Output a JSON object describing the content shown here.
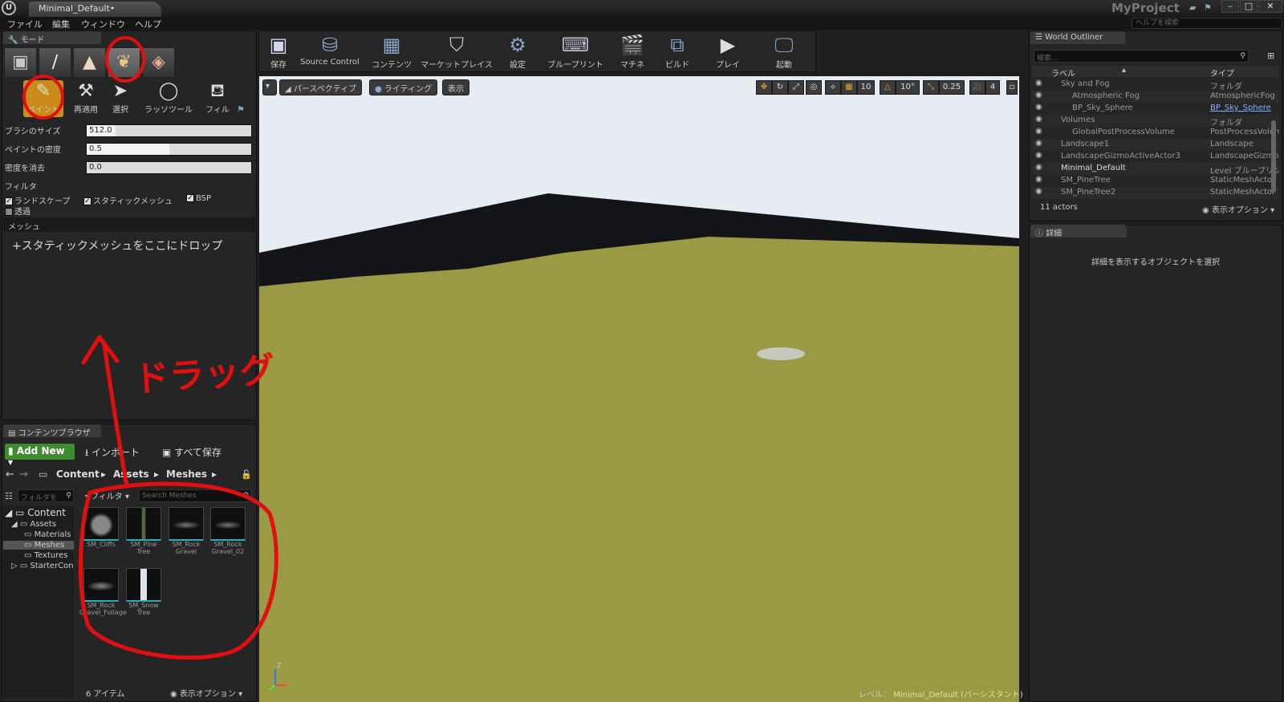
{
  "window": {
    "doc_tab": "Minimal_Default•",
    "project_name": "MyProject",
    "help_placeholder": "ヘルプを検索"
  },
  "menu": [
    "ファイル",
    "編集",
    "ウィンドウ",
    "ヘルプ"
  ],
  "modes": {
    "tab": "モード",
    "tools": [
      "ペイント",
      "再適用",
      "選択",
      "ラッソツール",
      "フィル"
    ],
    "brush_size_label": "ブラシのサイズ",
    "brush_size_value": "512.0",
    "paint_density_label": "ペイントの密度",
    "paint_density_value": "0.5",
    "paint_density_fraction": 0.5,
    "erase_density_label": "密度を消去",
    "erase_density_value": "0.0",
    "filter_label": "フィルタ",
    "filters": [
      {
        "label": "ランドスケープ",
        "checked": true
      },
      {
        "label": "スタティックメッシュ",
        "checked": true
      },
      {
        "label": "BSP",
        "checked": true
      },
      {
        "label": "透過",
        "checked": false
      }
    ],
    "mesh_section": "メッシュ",
    "drop_hint": "+スタティックメッシュをここにドロップ"
  },
  "content_browser": {
    "tab": "コンテンツブラウザ",
    "add_new": "Add New",
    "import": "インポート",
    "save_all": "すべて保存",
    "breadcrumb": [
      "Content",
      "Assets",
      "Meshes"
    ],
    "folder_search_placeholder": "フォルダを",
    "filter_button": "フィルタ",
    "search_placeholder": "Search Meshes",
    "tree": [
      {
        "label": "Content",
        "level": 0
      },
      {
        "label": "Assets",
        "level": 1
      },
      {
        "label": "Materials",
        "level": 2
      },
      {
        "label": "Meshes",
        "level": 2
      },
      {
        "label": "Textures",
        "level": 2
      },
      {
        "label": "StarterCon",
        "level": 1
      }
    ],
    "assets": [
      {
        "line1": "SM_Cliffs",
        "line2": ""
      },
      {
        "line1": "SM_Pine",
        "line2": "Tree"
      },
      {
        "line1": "SM_Rock",
        "line2": "Gravel"
      },
      {
        "line1": "SM_Rock",
        "line2": "Gravel_02"
      },
      {
        "line1": "SM_Rock",
        "line2": "Gravel_Foliage"
      },
      {
        "line1": "SM_Snow",
        "line2": "Tree"
      }
    ],
    "item_count": "6 アイテム",
    "view_options": "表示オプション"
  },
  "toolbar": [
    "保存",
    "Source Control",
    "コンテンツ",
    "マーケットプレイス",
    "設定",
    "ブループリント",
    "マチネ",
    "ビルド",
    "プレイ",
    "起動"
  ],
  "viewport": {
    "perspective": "パースペクティブ",
    "lighting": "ライティング",
    "show": "表示",
    "grid_snap": "10",
    "rot_snap": "10°",
    "scale_snap": "0.25",
    "cam_speed": "4",
    "level_prefix": "レベル：",
    "level_name": "Minimal_Default (パーシスタント)"
  },
  "outliner": {
    "tab": "World Outliner",
    "search_placeholder": "検索...",
    "col_label": "ラベル",
    "col_type": "タイプ",
    "rows": [
      {
        "label": "Sky and Fog",
        "type": "フォルダ",
        "indent": 1
      },
      {
        "label": "Atmospheric Fog",
        "type": "AtmosphericFog",
        "indent": 2
      },
      {
        "label": "BP_Sky_Sphere",
        "type": "BP_Sky_Sphere",
        "indent": 2
      },
      {
        "label": "Volumes",
        "type": "フォルダ",
        "indent": 1
      },
      {
        "label": "GlobalPostProcessVolume",
        "type": "PostProcessVolume",
        "indent": 2
      },
      {
        "label": "Landscape1",
        "type": "Landscape",
        "indent": 1
      },
      {
        "label": "LandscapeGizmoActiveActor3",
        "type": "LandscapeGizmoActiveActor",
        "indent": 1
      },
      {
        "label": "Minimal_Default",
        "type": "Level ブループリント",
        "indent": 1
      },
      {
        "label": "SM_PineTree",
        "type": "StaticMeshActor",
        "indent": 1
      },
      {
        "label": "SM_PineTree2",
        "type": "StaticMeshActor",
        "indent": 1
      }
    ],
    "actor_count": "11 actors",
    "view_options": "表示オプション"
  },
  "details": {
    "tab": "詳細",
    "empty_msg": "詳細を表示するオブジェクトを選択"
  },
  "annotation": {
    "text": "ドラッグ",
    "color": "#e01010"
  }
}
